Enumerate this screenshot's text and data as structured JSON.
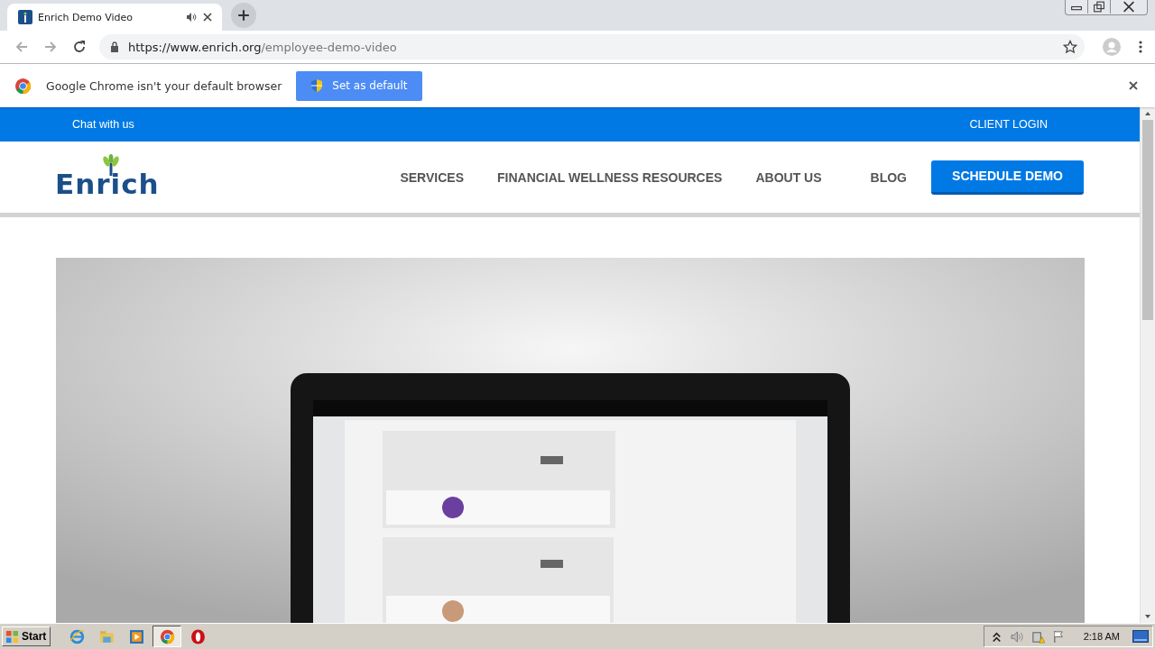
{
  "tab": {
    "title": "Enrich Demo Video"
  },
  "address_bar": {
    "host": "https://www.enrich.org",
    "path": "/employee-demo-video"
  },
  "infobar": {
    "message": "Google Chrome isn't your default browser",
    "button": "Set as default"
  },
  "topbar": {
    "chat": "Chat with us",
    "login": "CLIENT LOGIN"
  },
  "logo": "Enrich",
  "nav": [
    "SERVICES",
    "FINANCIAL WELLNESS RESOURCES",
    "ABOUT US",
    "BLOG"
  ],
  "cta": "SCHEDULE DEMO",
  "taskbar": {
    "start": "Start",
    "clock": "2:18 AM",
    "apps": [
      {
        "kind": "ie",
        "selected": false
      },
      {
        "kind": "explorer",
        "selected": false
      },
      {
        "kind": "media",
        "selected": false
      },
      {
        "kind": "chrome",
        "selected": true
      },
      {
        "kind": "opera",
        "selected": false
      }
    ]
  }
}
